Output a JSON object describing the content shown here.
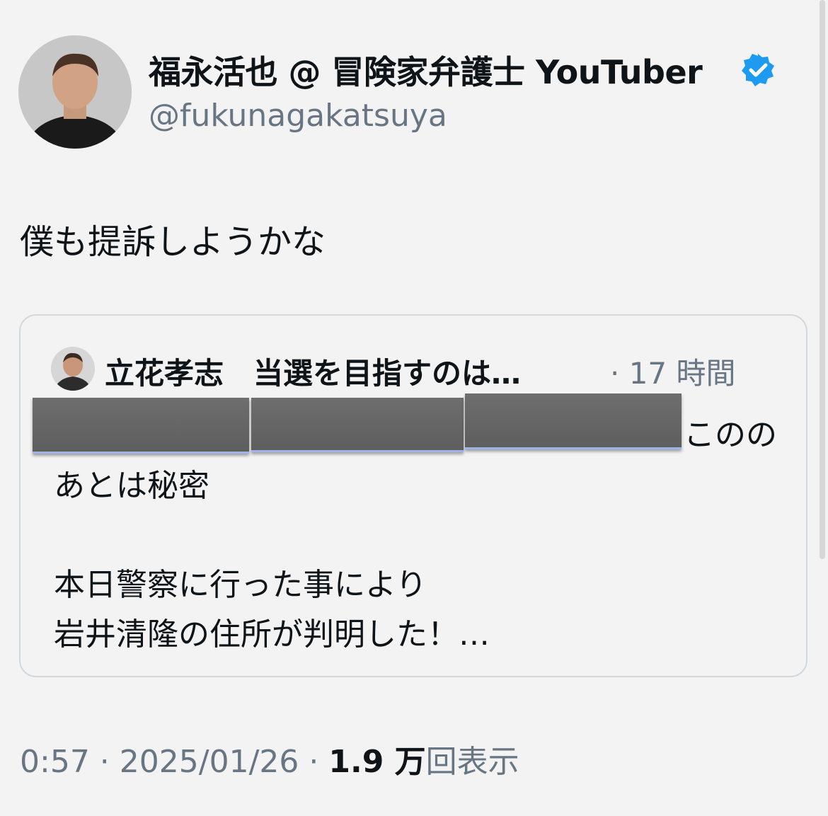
{
  "author": {
    "display_name": "福永活也 @ 冒険家弁護士 YouTuber",
    "handle": "@fukunagakatsuya",
    "verified_color": "#1d9bf0"
  },
  "tweet": {
    "text": "僕も提訴しようかな"
  },
  "quoted": {
    "author_name": "立花孝志　当選を目指すのは…",
    "time": "· 17 時間",
    "line1_tail": "このの",
    "line2": "あとは秘密",
    "line3": "本日警察に行った事により",
    "line4": "岩井清隆の住所が判明した！…"
  },
  "meta": {
    "time": "0:57",
    "sep1": " · ",
    "date": "2025/01/26",
    "sep2": " · ",
    "views_count": "1.9 万",
    "views_label": "回表示"
  }
}
